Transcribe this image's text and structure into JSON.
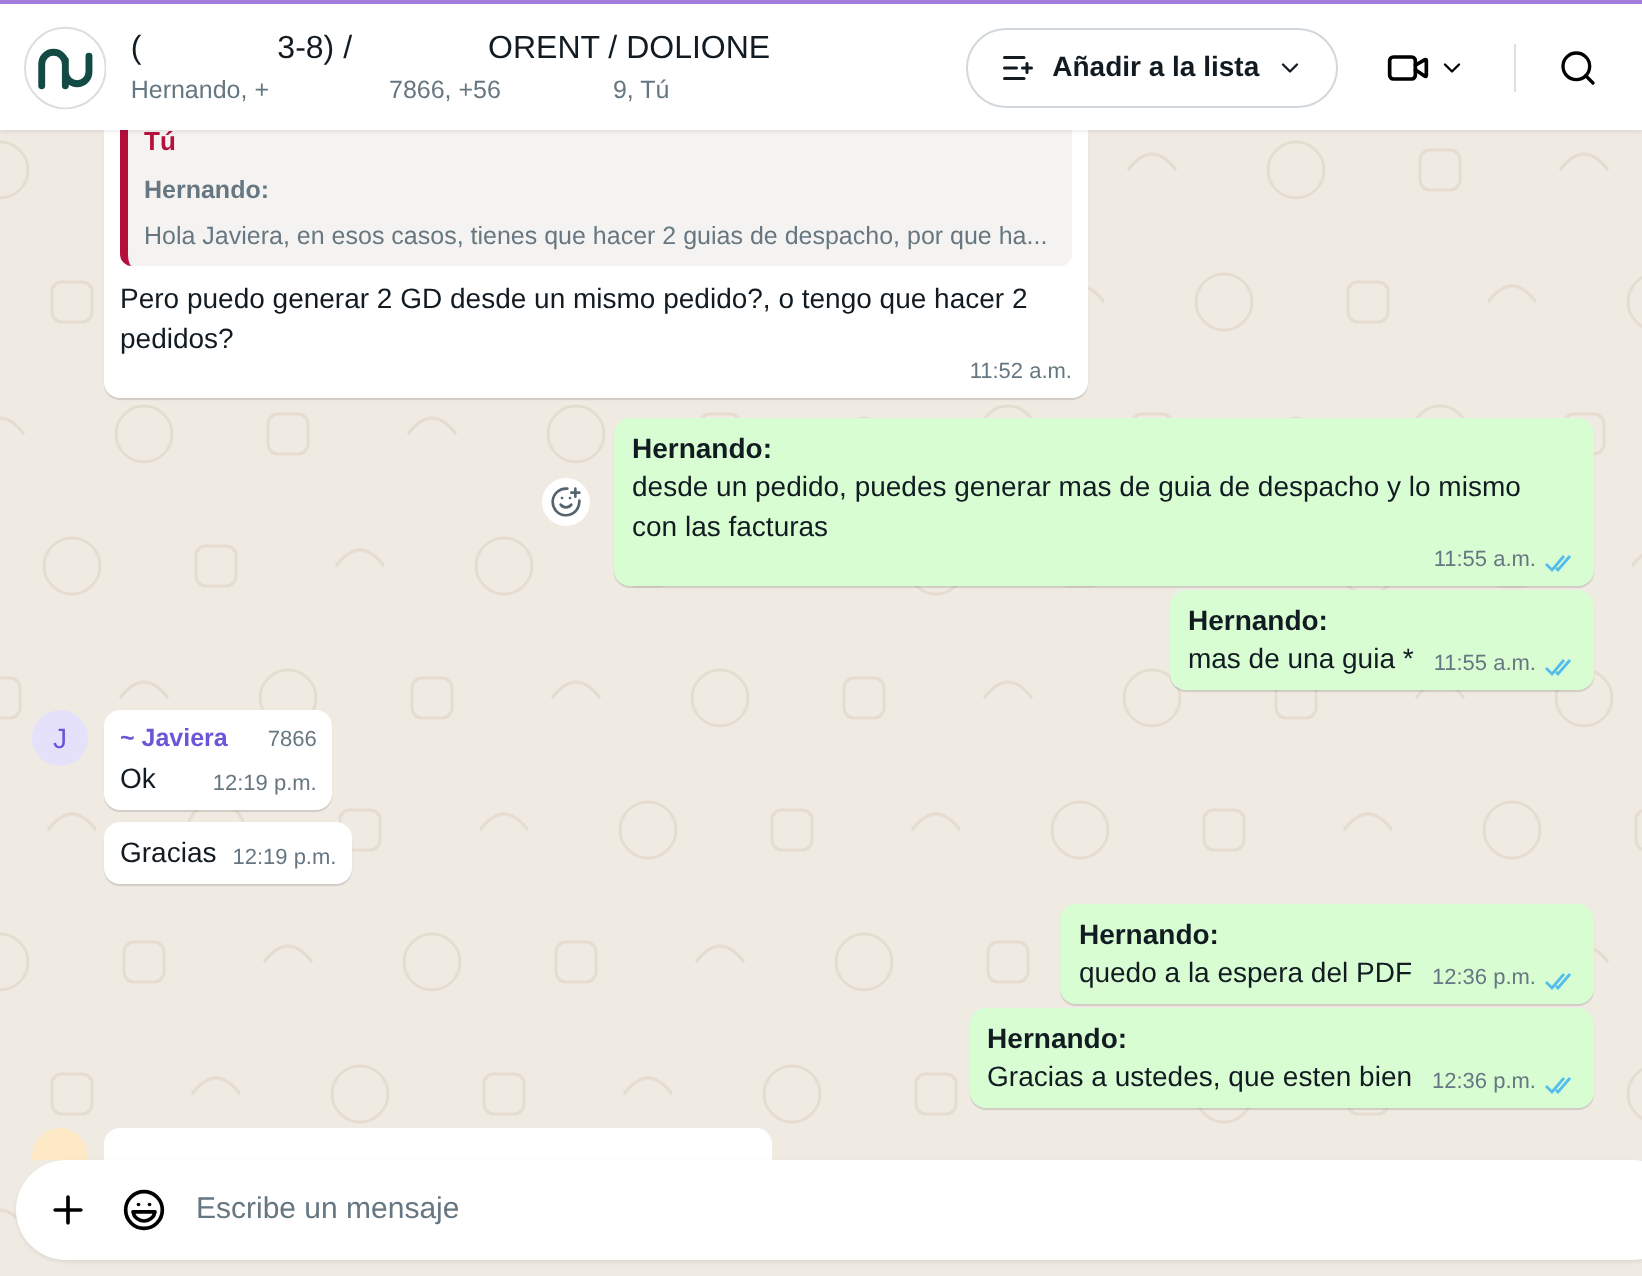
{
  "header": {
    "title_parts": [
      "(",
      "3-8) /",
      "ORENT / DOLIONE"
    ],
    "subtitle_parts": [
      "Hernando, +",
      "7866, +56",
      "9, Tú"
    ],
    "add_list_button": "Añadir a la lista"
  },
  "messages": [
    {
      "kind": "incoming",
      "quote": {
        "author": "Tú",
        "sender": "Hernando:",
        "text": "Hola Javiera, en esos casos, tienes que hacer 2 guias de despacho, por que ha..."
      },
      "text": "Pero puedo generar 2 GD desde un mismo pedido?, o tengo que hacer 2 pedidos?",
      "time": "11:52 a.m."
    },
    {
      "kind": "outgoing",
      "sender": "Hernando:",
      "text": "desde un pedido, puedes generar mas de guia de despacho y lo mismo con las facturas",
      "time": "11:55 a.m.",
      "read": true,
      "react": true
    },
    {
      "kind": "outgoing",
      "sender": "Hernando:",
      "text": "mas de una guia *",
      "time": "11:55 a.m.",
      "read": true,
      "react": false
    },
    {
      "kind": "incoming",
      "avatar": "J",
      "sender": "~ Javiera",
      "phone": "7866",
      "text": "Ok",
      "time": "12:19 p.m."
    },
    {
      "kind": "incoming",
      "text": "Gracias",
      "time": "12:19 p.m."
    },
    {
      "kind": "outgoing",
      "sender": "Hernando:",
      "text": "quedo a la espera del PDF",
      "time": "12:36 p.m.",
      "read": true,
      "react": false
    },
    {
      "kind": "outgoing",
      "sender": "Hernando:",
      "text": "Gracias a ustedes, que esten bien",
      "time": "12:36 p.m.",
      "read": true,
      "react": false
    },
    {
      "kind": "peek"
    }
  ],
  "composer": {
    "placeholder": "Escribe un mensaje"
  }
}
